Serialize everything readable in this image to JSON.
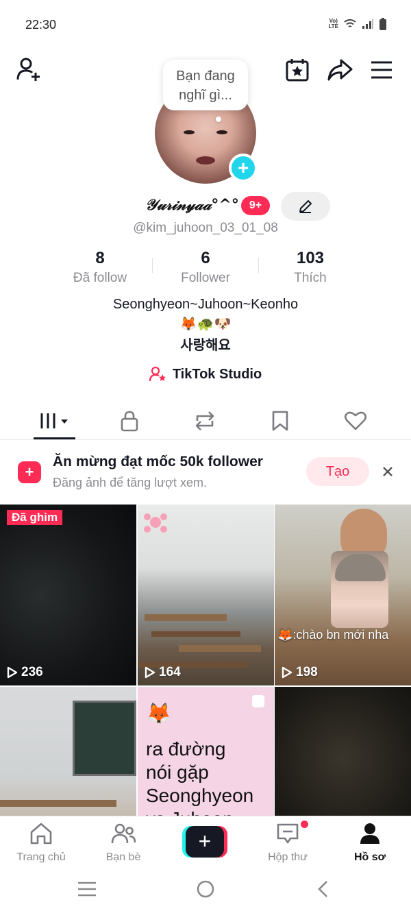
{
  "status_bar": {
    "time": "22:30",
    "network_label": "Vo)) LTE",
    "icons": [
      "volte-icon",
      "wifi-icon",
      "signal-icon",
      "battery-icon"
    ]
  },
  "header": {
    "icons": [
      "add-friend-icon",
      "calendar-star-icon",
      "share-icon",
      "menu-icon"
    ]
  },
  "profile": {
    "thought_bubble": [
      "Bạn đang",
      "nghĩ gì..."
    ],
    "display_name": "𝒴𝓊𝓇𝒾𝓃𝓎𝒶𝒶°^°",
    "notification_badge": "9+",
    "handle": "@kim_juhoon_03_01_08",
    "stats": [
      {
        "value": "8",
        "label": "Đã follow"
      },
      {
        "value": "6",
        "label": "Follower"
      },
      {
        "value": "103",
        "label": "Thích"
      }
    ],
    "bio": [
      "Seonghyeon~Juhoon~Keonho",
      "🦊🐢🐶",
      "사랑해요"
    ],
    "studio_label": "TikTok Studio"
  },
  "tabs": [
    "videos-grid-icon",
    "lock-icon",
    "repost-icon",
    "bookmark-icon",
    "heart-icon"
  ],
  "banner": {
    "title": "Ăn mừng đạt mốc 50k follower",
    "subtitle": "Đăng ảnh để tăng lượt xem.",
    "create_label": "Tạo"
  },
  "videos": [
    {
      "views": "236",
      "pinned_label": "Đã ghim"
    },
    {
      "views": "164"
    },
    {
      "views": "198",
      "caption": "🦊:chào bn mới nha"
    },
    {},
    {
      "fox": "🦊",
      "text": [
        "ra đường",
        "nói gặp",
        "Seonghyeon",
        "vs Juhoon"
      ]
    },
    {}
  ],
  "bottom_nav": [
    {
      "label": "Trang chủ",
      "icon": "home-icon"
    },
    {
      "label": "Bạn bè",
      "icon": "friends-icon"
    },
    {
      "label": "",
      "icon": "plus-icon"
    },
    {
      "label": "Hộp thư",
      "icon": "inbox-icon"
    },
    {
      "label": "Hồ sơ",
      "icon": "profile-icon"
    }
  ],
  "colors": {
    "brand_red": "#fe2c55",
    "brand_cyan": "#20d5ec",
    "text_primary": "#161823",
    "text_secondary": "#8a8b91"
  }
}
